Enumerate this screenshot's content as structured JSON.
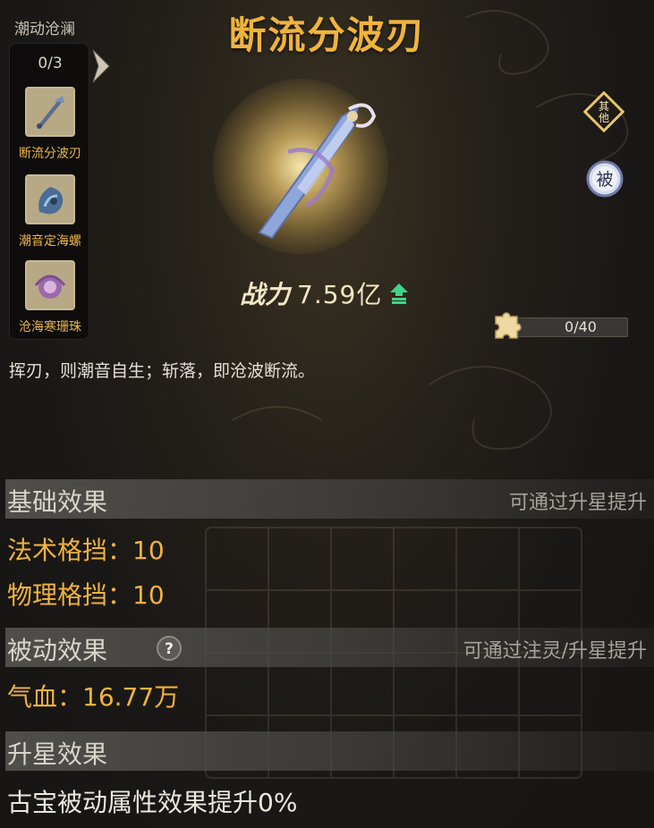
{
  "set": {
    "title": "潮动沧澜",
    "progress": "0/3",
    "items": [
      {
        "name": "断流分波刃",
        "icon": "blade-icon"
      },
      {
        "name": "潮音定海螺",
        "icon": "conch-icon"
      },
      {
        "name": "沧海寒珊珠",
        "icon": "pearl-icon"
      }
    ]
  },
  "item": {
    "title": "断流分波刃",
    "power_label": "战力",
    "power_value": "7.59亿",
    "description": "挥刃，则潮音自生；斩落，即沧波断流。"
  },
  "badges": {
    "other": "其他",
    "passive": "被"
  },
  "piece_progress": {
    "text": "0/40",
    "value": 0
  },
  "sections": {
    "basic": {
      "title": "基础效果",
      "hint": "可通过升星提升",
      "stats": [
        "法术格挡：10",
        "物理格挡：10"
      ]
    },
    "passive": {
      "title": "被动效果",
      "hint": "可通过注灵/升星提升",
      "stats": [
        "气血：16.77万"
      ]
    },
    "star": {
      "title": "升星效果",
      "text": "古宝被动属性效果提升0%"
    }
  },
  "colors": {
    "title_gold": "#f0b43c",
    "stat_gold": "#f0b33e",
    "power_up_green": "#3fd48a"
  }
}
